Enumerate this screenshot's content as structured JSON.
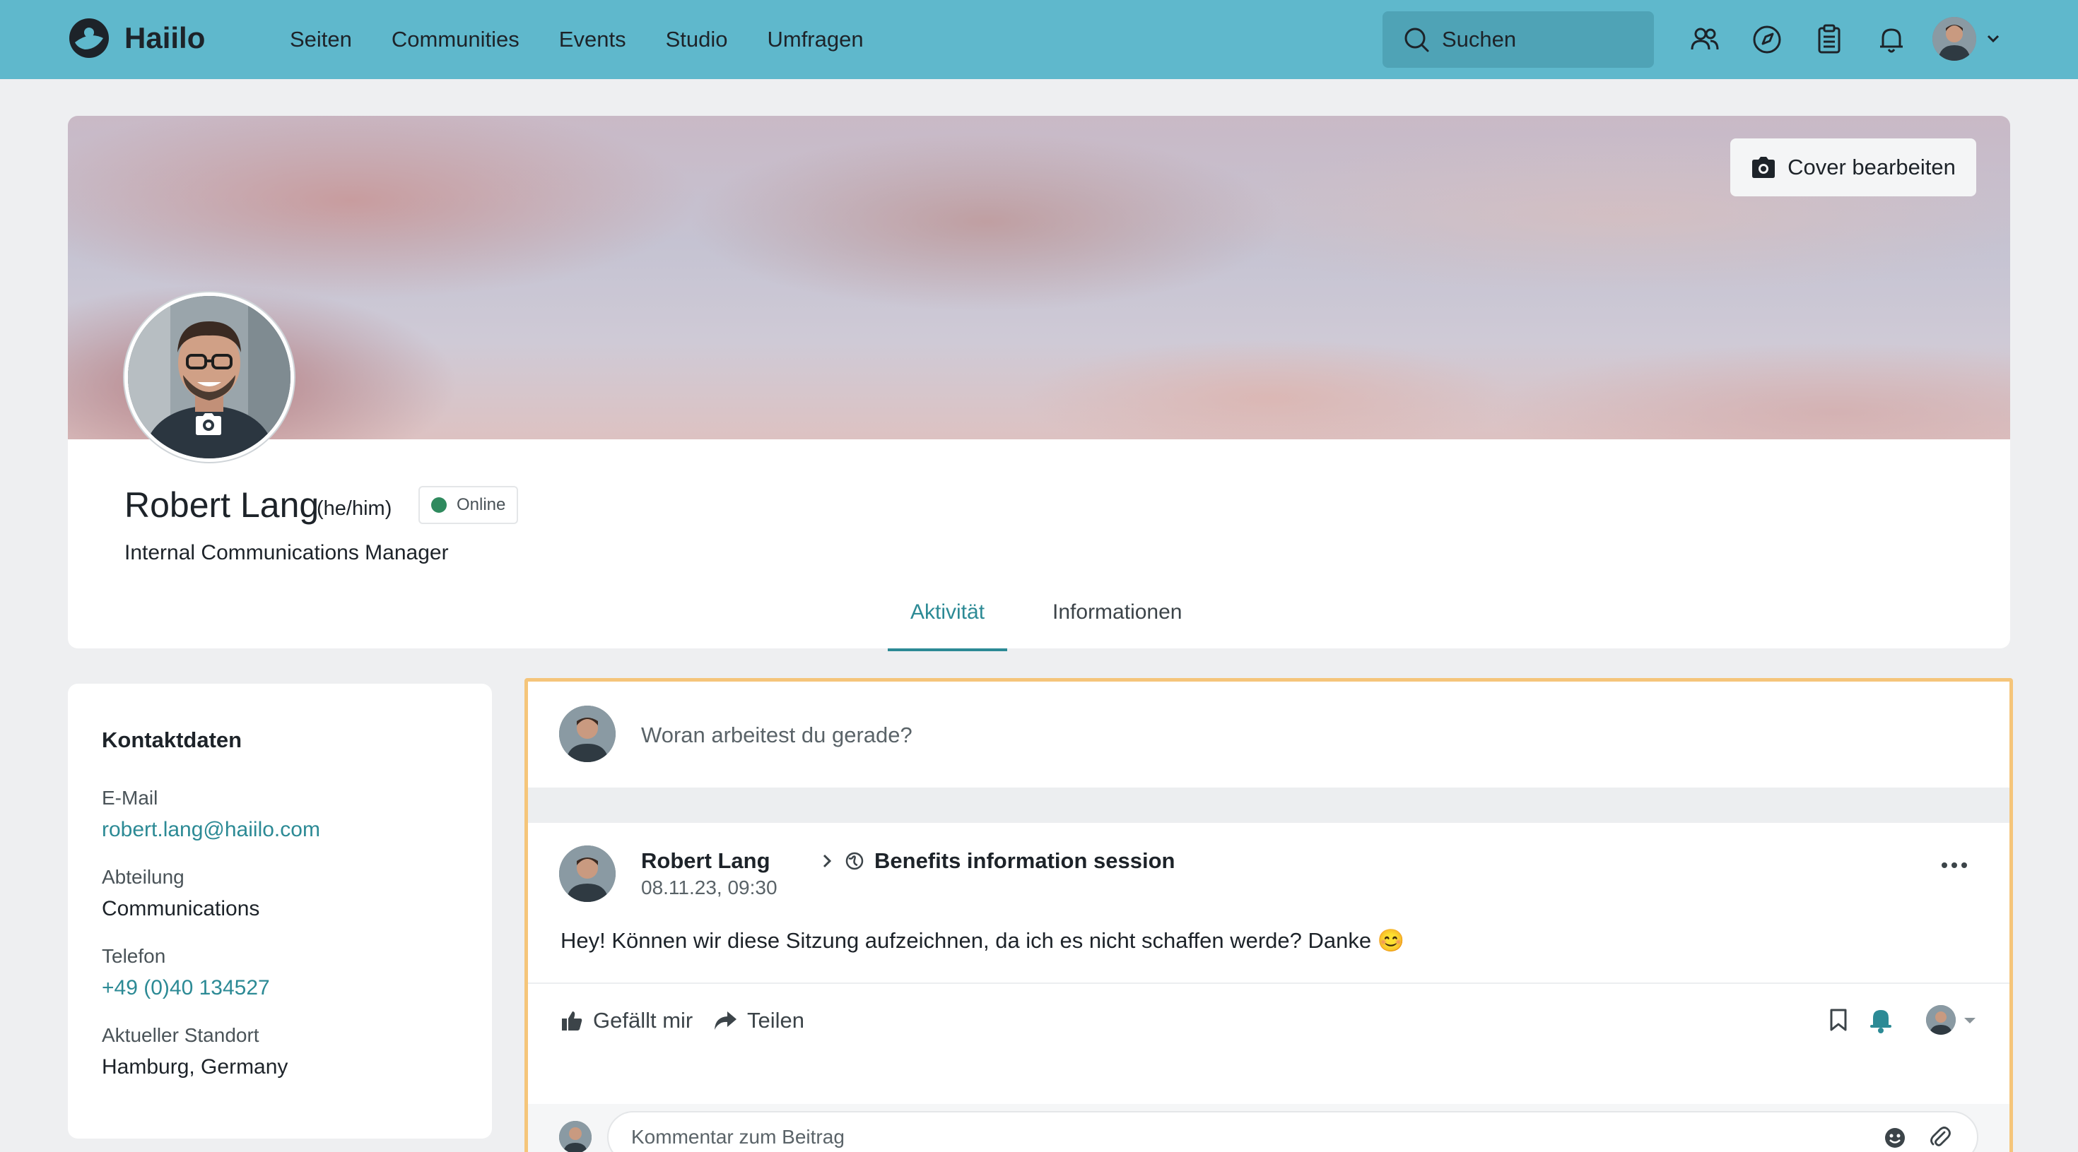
{
  "app": {
    "name": "Haiilo"
  },
  "nav": {
    "items": [
      "Seiten",
      "Communities",
      "Events",
      "Studio",
      "Umfragen"
    ]
  },
  "search": {
    "placeholder": "Suchen"
  },
  "header_icons": [
    "people-icon",
    "compass-icon",
    "clipboard-icon",
    "bell-icon"
  ],
  "cover": {
    "edit_label": "Cover bearbeiten"
  },
  "profile": {
    "name": "Robert Lang",
    "pronouns": "(he/him)",
    "status": "Online",
    "status_color": "#2f8a5e",
    "job_title": "Internal Communications Manager"
  },
  "tabs": {
    "activity": "Aktivität",
    "info": "Informationen",
    "active": "Aktivität"
  },
  "contact": {
    "title": "Kontaktdaten",
    "email_label": "E-Mail",
    "email": "robert.lang@haiilo.com",
    "department_label": "Abteilung",
    "department": "Communications",
    "phone_label": "Telefon",
    "phone": "+49 (0)40 134527",
    "location_label": "Aktueller Standort",
    "location": "Hamburg, Germany"
  },
  "composer": {
    "placeholder": "Woran arbeitest du gerade?"
  },
  "post": {
    "author": "Robert Lang",
    "target": "Benefits information session",
    "date": "08.11.23, 09:30",
    "body": "Hey! Können wir diese Sitzung aufzeichnen, da ich es nicht schaffen werde? Danke 😊",
    "like_label": "Gefällt mir",
    "share_label": "Teilen"
  },
  "comment": {
    "placeholder": "Kommentar zum Beitrag"
  },
  "colors": {
    "topbar": "#5fb8cc",
    "accent": "#2c8a95",
    "highlight_border": "#f5c57a"
  }
}
